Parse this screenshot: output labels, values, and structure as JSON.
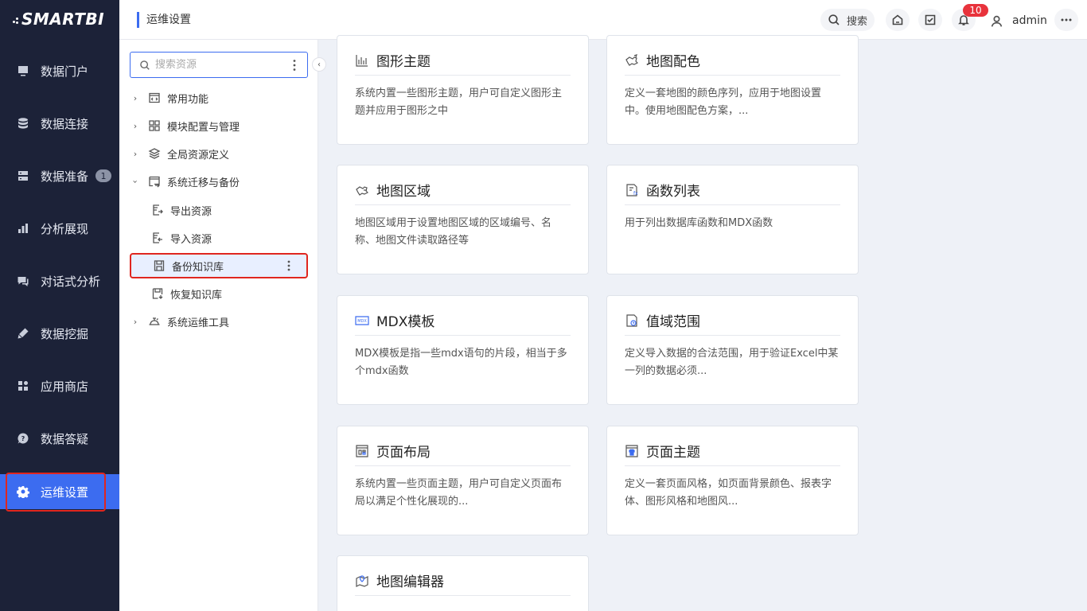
{
  "brand": "SMARTBI",
  "nav": [
    {
      "label": "数据门户",
      "icon": "portal-icon"
    },
    {
      "label": "数据连接",
      "icon": "database-icon"
    },
    {
      "label": "数据准备",
      "icon": "server-icon",
      "badge": "1"
    },
    {
      "label": "分析展现",
      "icon": "bar-chart-icon"
    },
    {
      "label": "对话式分析",
      "icon": "chat-icon"
    },
    {
      "label": "数据挖掘",
      "icon": "pickaxe-icon"
    },
    {
      "label": "应用商店",
      "icon": "apps-icon"
    },
    {
      "label": "数据答疑",
      "icon": "question-icon"
    },
    {
      "label": "运维设置",
      "icon": "gear-icon",
      "active": true
    }
  ],
  "header": {
    "title": "运维设置",
    "search_label": "搜索",
    "notification_count": "10",
    "username": "admin"
  },
  "tree": {
    "search_placeholder": "搜索资源",
    "items": [
      {
        "label": "常用功能",
        "icon": "code-window-icon",
        "expanded": false
      },
      {
        "label": "模块配置与管理",
        "icon": "grid-icon",
        "expanded": false
      },
      {
        "label": "全局资源定义",
        "icon": "layers-icon",
        "expanded": false
      },
      {
        "label": "系统迁移与备份",
        "icon": "migrate-icon",
        "expanded": true
      },
      {
        "label": "导出资源",
        "icon": "export-icon",
        "child": true
      },
      {
        "label": "导入资源",
        "icon": "import-icon",
        "child": true
      },
      {
        "label": "备份知识库",
        "icon": "backup-icon",
        "child": true,
        "selected": true
      },
      {
        "label": "恢复知识库",
        "icon": "restore-icon",
        "child": true
      },
      {
        "label": "系统运维工具",
        "icon": "tools-icon",
        "expanded": false
      }
    ]
  },
  "cards": [
    {
      "title": "图形主题",
      "icon": "chart-theme-icon",
      "desc": "系统内置一些图形主题，用户可自定义图形主题并应用于图形之中"
    },
    {
      "title": "地图配色",
      "icon": "map-color-icon",
      "desc": "定义一套地图的颜色序列，应用于地图设置中。使用地图配色方案，..."
    },
    {
      "title": "地图区域",
      "icon": "map-region-icon",
      "desc": "地图区域用于设置地图区域的区域编号、名称、地图文件读取路径等"
    },
    {
      "title": "函数列表",
      "icon": "function-list-icon",
      "desc": "用于列出数据库函数和MDX函数"
    },
    {
      "title": "MDX模板",
      "icon": "mdx-icon",
      "desc": "MDX模板是指一些mdx语句的片段，相当于多个mdx函数"
    },
    {
      "title": "值域范围",
      "icon": "value-range-icon",
      "desc": "定义导入数据的合法范围，用于验证Excel中某一列的数据必须..."
    },
    {
      "title": "页面布局",
      "icon": "page-layout-icon",
      "desc": "系统内置一些页面主题，用户可自定义页面布局以满足个性化展现的..."
    },
    {
      "title": "页面主题",
      "icon": "page-theme-icon",
      "desc": "定义一套页面风格，如页面背景颜色、报表字体、图形风格和地图风..."
    },
    {
      "title": "地图编辑器",
      "icon": "map-editor-icon",
      "desc": ""
    }
  ],
  "colors": {
    "sidebar": "#1c2238",
    "accent": "#3c6cf0",
    "highlight": "#e0261f",
    "badge": "#e8333c"
  }
}
